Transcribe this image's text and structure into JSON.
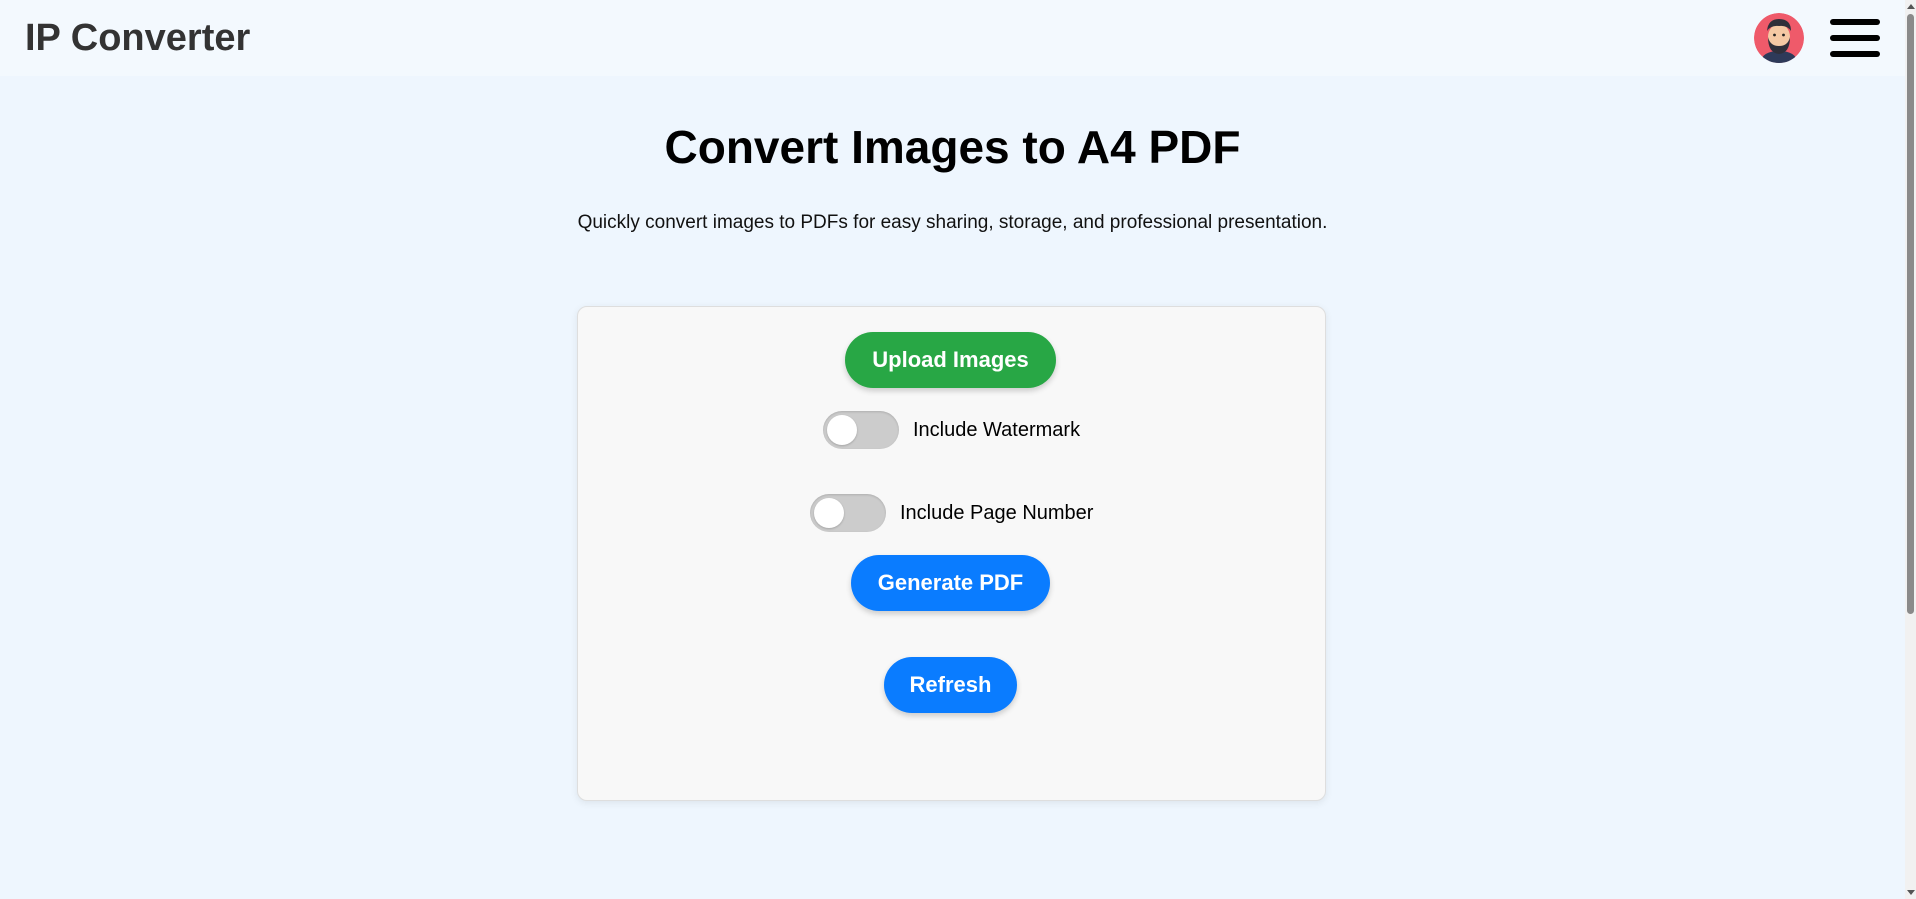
{
  "header": {
    "brand": "IP Converter",
    "avatar_icon": "bearded-man-avatar",
    "menu_icon": "hamburger-menu-icon"
  },
  "main": {
    "title": "Convert Images to A4 PDF",
    "subtitle": "Quickly convert images to PDFs for easy sharing, storage, and professional presentation."
  },
  "card": {
    "upload_label": "Upload Images",
    "watermark_label": "Include Watermark",
    "watermark_on": false,
    "page_number_label": "Include Page Number",
    "page_number_on": false,
    "generate_label": "Generate PDF",
    "refresh_label": "Refresh"
  },
  "colors": {
    "upload_button": "#28a745",
    "primary_button": "#0a7cff",
    "toggle_off": "#cccccc",
    "page_bg": "#eef6fe"
  }
}
